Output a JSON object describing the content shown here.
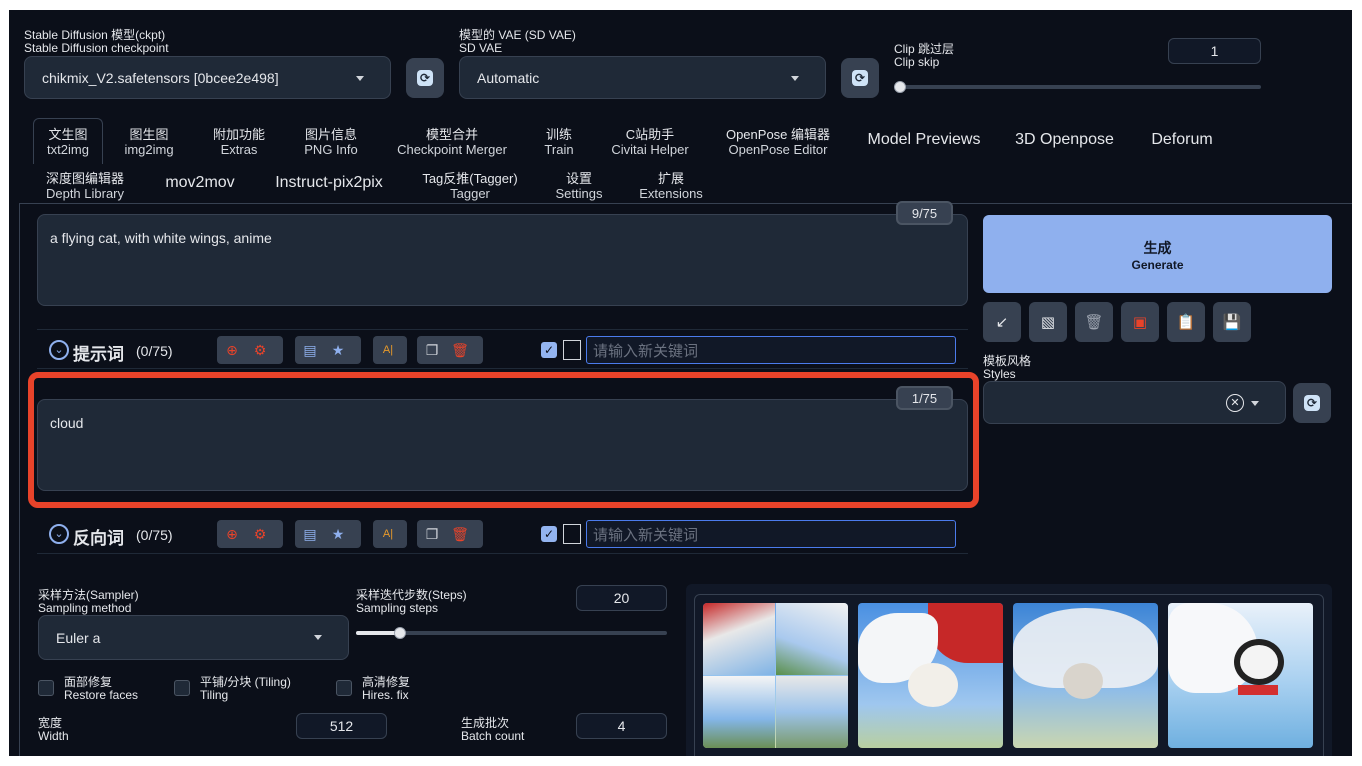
{
  "top": {
    "checkpoint_label_cn": "Stable Diffusion 模型(ckpt)",
    "checkpoint_label_en": "Stable Diffusion checkpoint",
    "checkpoint_value": "chikmix_V2.safetensors [0bcee2e498]",
    "vae_label_cn": "模型的 VAE (SD VAE)",
    "vae_label_en": "SD VAE",
    "vae_value": "Automatic",
    "clip_label_cn": "Clip 跳过层",
    "clip_label_en": "Clip skip",
    "clip_value": "1",
    "clip_fraction": 0.0
  },
  "tabs_row1": [
    {
      "cn": "文生图",
      "en": "txt2img"
    },
    {
      "cn": "图生图",
      "en": "img2img"
    },
    {
      "cn": "附加功能",
      "en": "Extras"
    },
    {
      "cn": "图片信息",
      "en": "PNG Info"
    },
    {
      "cn": "模型合并",
      "en": "Checkpoint Merger"
    },
    {
      "cn": "训练",
      "en": "Train"
    },
    {
      "cn": "C站助手",
      "en": "Civitai Helper"
    },
    {
      "cn": "OpenPose 编辑器",
      "en": "OpenPose Editor"
    },
    {
      "cn": "Model Previews",
      "en": ""
    },
    {
      "cn": "3D Openpose",
      "en": ""
    },
    {
      "cn": "Deforum",
      "en": ""
    }
  ],
  "tabs_row2": [
    {
      "cn": "深度图编辑器",
      "en": "Depth Library"
    },
    {
      "cn": "mov2mov",
      "en": ""
    },
    {
      "cn": "Instruct-pix2pix",
      "en": ""
    },
    {
      "cn": "Tag反推(Tagger)",
      "en": "Tagger"
    },
    {
      "cn": "设置",
      "en": "Settings"
    },
    {
      "cn": "扩展",
      "en": "Extensions"
    }
  ],
  "prompt": {
    "text": "a flying cat, with white wings, anime",
    "counter": "9/75"
  },
  "prompt_toolbar": {
    "title": "提示词",
    "count": "(0/75)",
    "keyword_placeholder": "请输入新关键词"
  },
  "negative": {
    "text": "cloud",
    "counter": "1/75"
  },
  "negative_toolbar": {
    "title": "反向词",
    "count": "(0/75)",
    "keyword_placeholder": "请输入新关键词"
  },
  "generate": {
    "cn": "生成",
    "en": "Generate"
  },
  "styles": {
    "cn": "模板风格",
    "en": "Styles"
  },
  "sampler": {
    "label_cn": "采样方法(Sampler)",
    "label_en": "Sampling method",
    "value": "Euler a"
  },
  "steps": {
    "label_cn": "采样迭代步数(Steps)",
    "label_en": "Sampling steps",
    "value": "20",
    "fraction": 0.14
  },
  "checkboxes": [
    {
      "cn": "面部修复",
      "en": "Restore faces"
    },
    {
      "cn": "平铺/分块 (Tiling)",
      "en": "Tiling"
    },
    {
      "cn": "高清修复",
      "en": "Hires. fix"
    }
  ],
  "width": {
    "label_cn": "宽度",
    "label_en": "Width",
    "value": "512"
  },
  "batch_count": {
    "label_cn": "生成批次",
    "label_en": "Batch count",
    "value": "4"
  },
  "icons": {
    "refresh": "refresh-icon",
    "globe": "globe-icon",
    "gear": "gear-icon",
    "trash": "trash-icon",
    "copy": "copy-icon",
    "bookmark": "bookmark-icon"
  },
  "colors": {
    "background": "#0b0f19",
    "generate": "#8fb0ee",
    "highlight": "#e8432a"
  }
}
